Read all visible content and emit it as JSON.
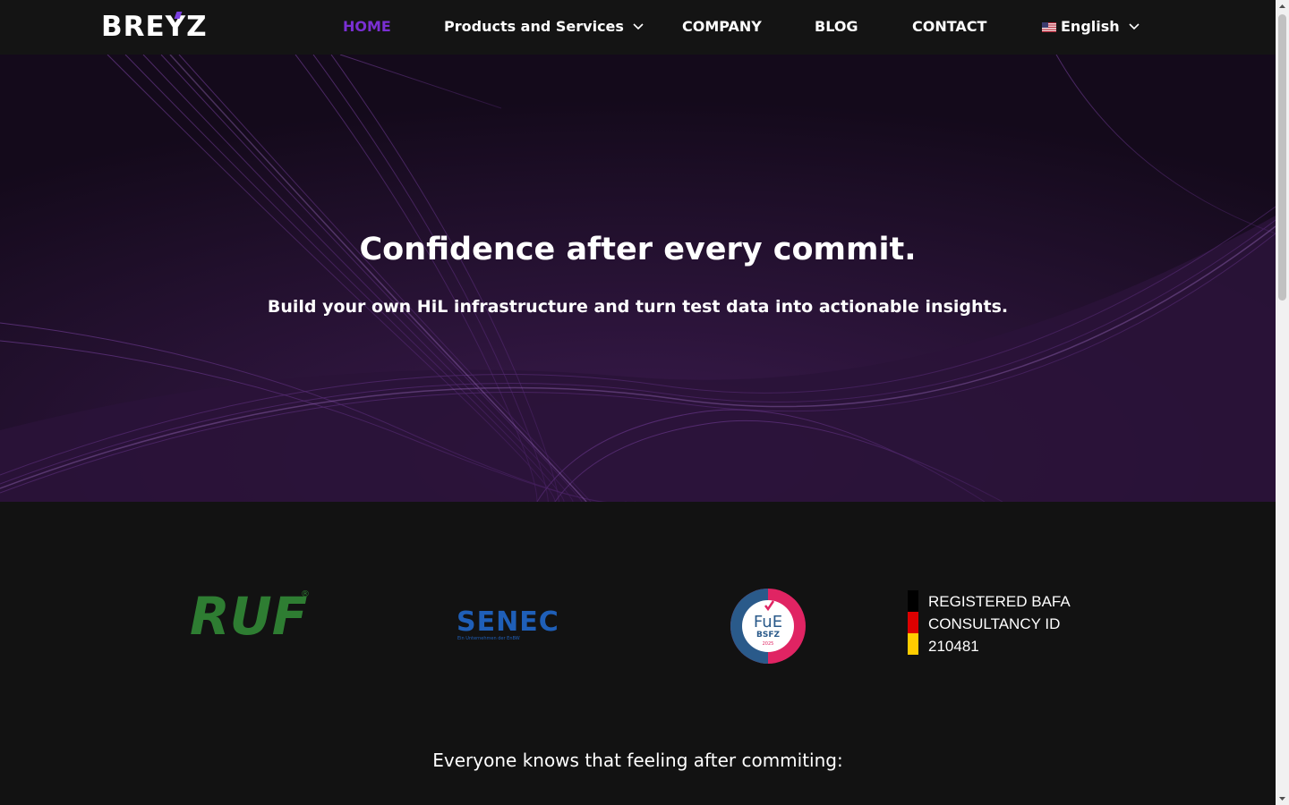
{
  "brand": {
    "logo_text": "BREYZ",
    "accent_color": "#7a2fd3"
  },
  "nav": {
    "items": [
      {
        "label": "HOME",
        "active": true
      },
      {
        "label": "Products and Services",
        "has_dropdown": true
      },
      {
        "label": "COMPANY"
      },
      {
        "label": "BLOG"
      },
      {
        "label": "CONTACT"
      }
    ],
    "language": {
      "label": "English",
      "flag_icon": "us-flag-icon",
      "has_dropdown": true
    }
  },
  "hero": {
    "title": "Confidence after every commit.",
    "subtitle": "Build your own HiL infrastructure and turn test data into actionable insights."
  },
  "partners": {
    "ruf": {
      "logo_text": "RUF",
      "mark": "®"
    },
    "senec": {
      "logo_text": "SENEC",
      "tagline": "Ein Unternehmen der EnBW"
    },
    "fue": {
      "line1": "FuE",
      "line2": "BSFZ",
      "line3": "2025"
    },
    "bafa": {
      "text": "REGISTERED BAFA CONSULTANCY ID 210481"
    }
  },
  "tagline": "Everyone knows that feeling after commiting:"
}
